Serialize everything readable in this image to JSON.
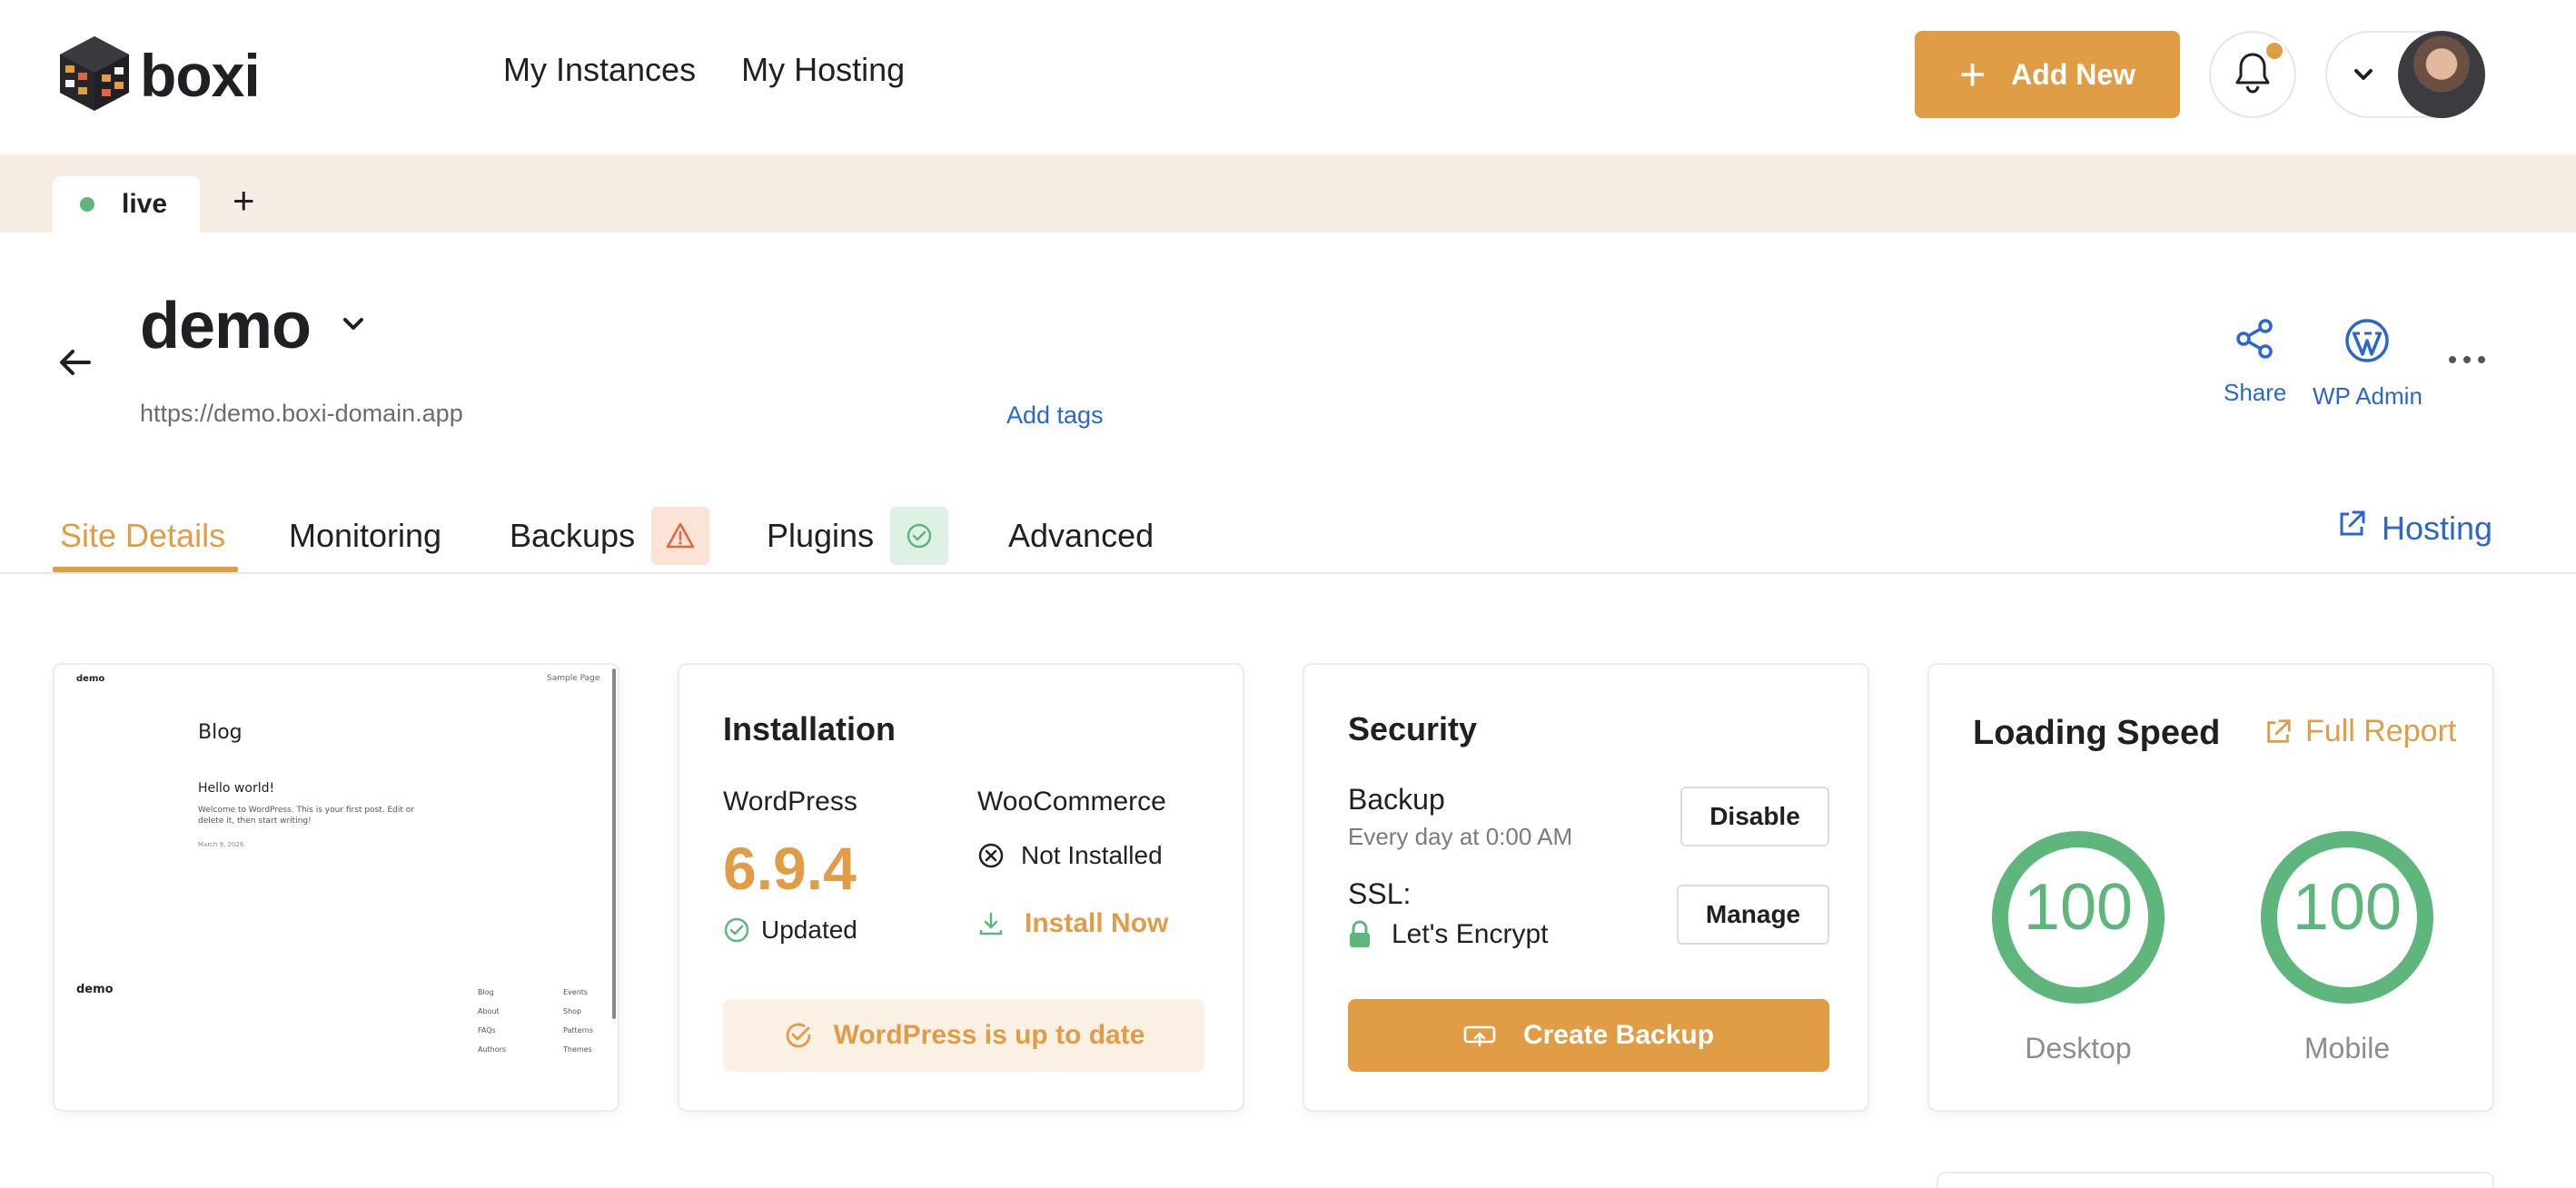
{
  "brand": {
    "name": "boxi"
  },
  "nav": {
    "items": [
      "My Instances",
      "My Hosting"
    ]
  },
  "header_actions": {
    "add_new": "Add New"
  },
  "instances": {
    "tabs": [
      {
        "label": "live",
        "status": "online"
      }
    ],
    "add_label": "+"
  },
  "site": {
    "name": "demo",
    "url": "https://demo.boxi-domain.app",
    "add_tags": "Add tags",
    "actions": {
      "share": "Share",
      "wp_admin": "WP Admin"
    }
  },
  "tabs": {
    "items": [
      {
        "label": "Site Details",
        "active": true
      },
      {
        "label": "Monitoring"
      },
      {
        "label": "Backups",
        "badge": "warning"
      },
      {
        "label": "Plugins",
        "badge": "ok"
      },
      {
        "label": "Advanced"
      }
    ],
    "hosting_link": "Hosting"
  },
  "preview": {
    "site_name": "demo",
    "nav_link": "Sample Page",
    "heading": "Blog",
    "post_title": "Hello world!",
    "post_excerpt": "Welcome to WordPress. This is your first post. Edit or delete it, then start writing!",
    "post_date": "March 9, 2026",
    "footer_brand": "demo",
    "footer_col1": [
      "Blog",
      "About",
      "FAQs",
      "Authors"
    ],
    "footer_col2": [
      "Events",
      "Shop",
      "Patterns",
      "Themes"
    ]
  },
  "installation": {
    "title": "Installation",
    "wordpress_label": "WordPress",
    "wordpress_version": "6.9.4",
    "wordpress_status": "Updated",
    "woocommerce_label": "WooCommerce",
    "woocommerce_status": "Not Installed",
    "install_now": "Install Now",
    "up_to_date": "WordPress is up to date"
  },
  "security": {
    "title": "Security",
    "backup_label": "Backup",
    "backup_schedule": "Every day at 0:00 AM",
    "disable_btn": "Disable",
    "ssl_label": "SSL:",
    "ssl_value": "Let's Encrypt",
    "manage_btn": "Manage",
    "create_backup": "Create Backup"
  },
  "speed": {
    "title": "Loading Speed",
    "full_report": "Full Report",
    "desktop_score": "100",
    "desktop_label": "Desktop",
    "mobile_score": "100",
    "mobile_label": "Mobile"
  },
  "colors": {
    "accent": "#e09d46",
    "link": "#2b66cc",
    "success": "#5eb67c",
    "strip": "#f6ede4"
  }
}
